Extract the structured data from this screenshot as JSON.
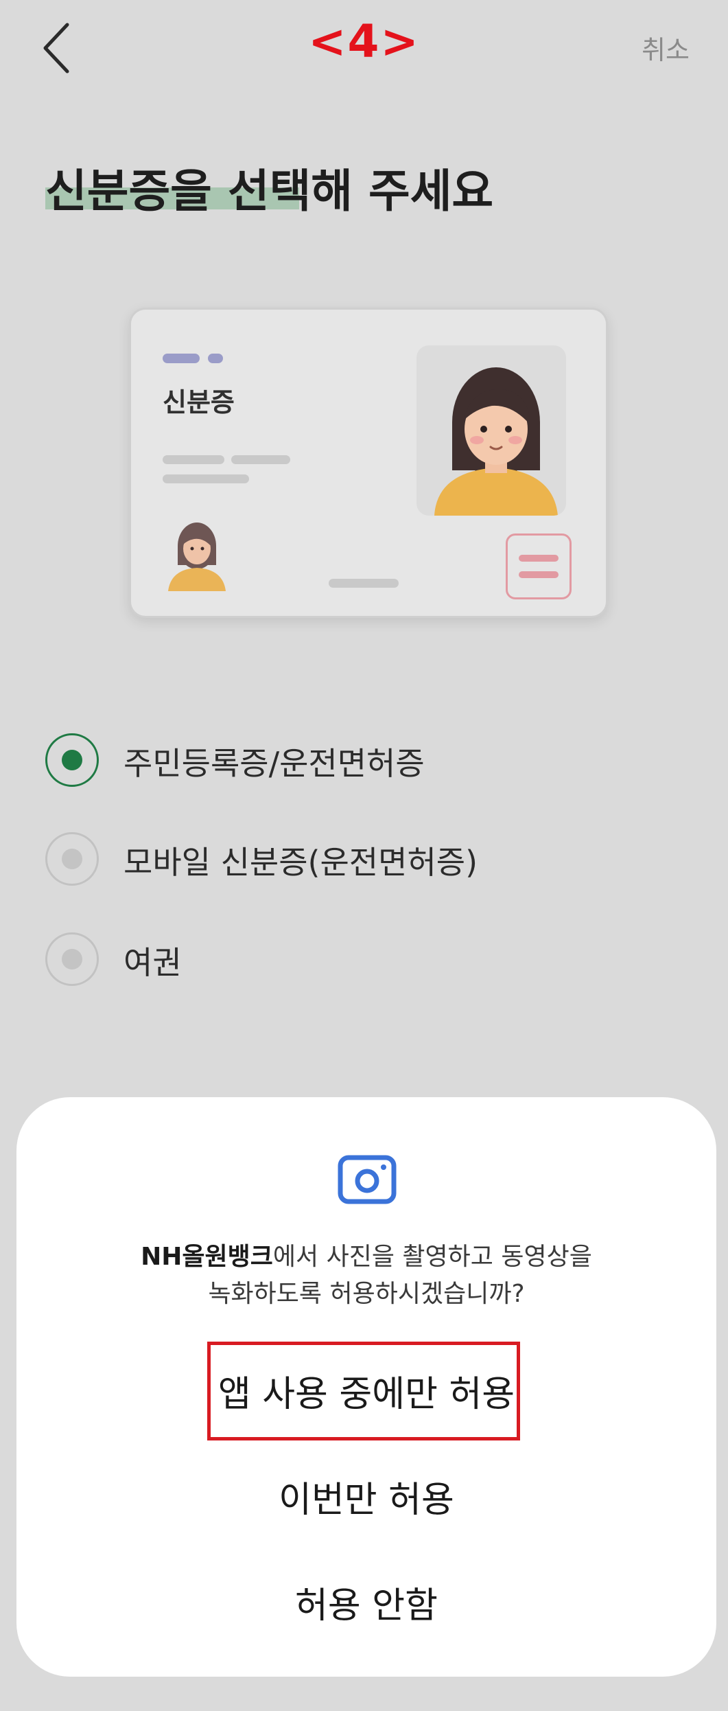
{
  "header": {
    "step_label": "<4>",
    "cancel_label": "취소"
  },
  "main": {
    "title": "신분증을 선택해 주세요",
    "card_label": "신분증",
    "options": [
      {
        "label": "주민등록증/운전면허증",
        "selected": true
      },
      {
        "label": "모바일 신분증(운전면허증)",
        "selected": false
      },
      {
        "label": "여권",
        "selected": false
      }
    ]
  },
  "dialog": {
    "app_name": "NH올원뱅크",
    "message_part1": "에서 사진을 촬영하고 동영상을",
    "message_line2": "녹화하도록 허용하시겠습니까?",
    "allow_while_using": "앱 사용 중에만 허용",
    "allow_once": "이번만 허용",
    "deny": "허용 안함"
  },
  "colors": {
    "accent_green": "#1f7a44",
    "step_red": "#e4121b",
    "dialog_icon_blue": "#3b73d9"
  }
}
